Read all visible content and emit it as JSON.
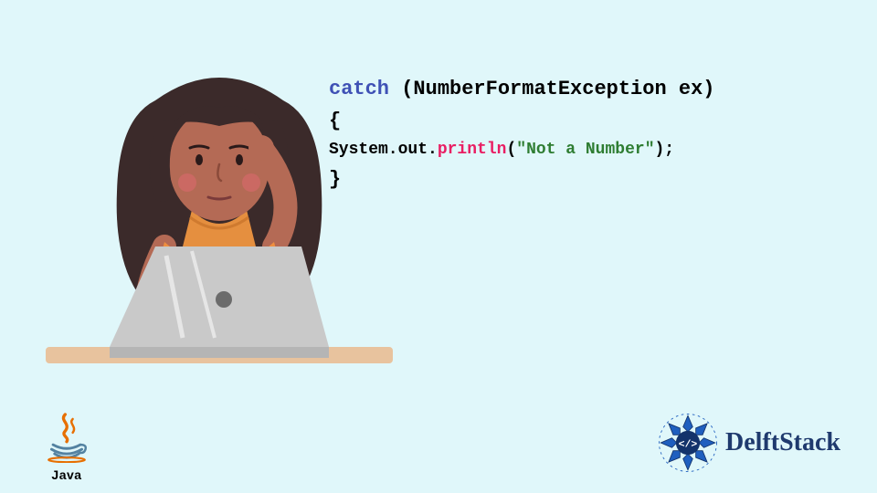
{
  "code": {
    "line1": {
      "catch": "catch",
      "open_paren": " (",
      "exception": "NumberFormatException ex",
      "close_paren": ")"
    },
    "line2": "{",
    "line3": {
      "prefix": " System.out.",
      "method": "println",
      "open_p": "(",
      "str": "\"Not a Number\"",
      "close": ");"
    },
    "line4": "}"
  },
  "java_label": "Java",
  "delft_label": "DelftStack"
}
